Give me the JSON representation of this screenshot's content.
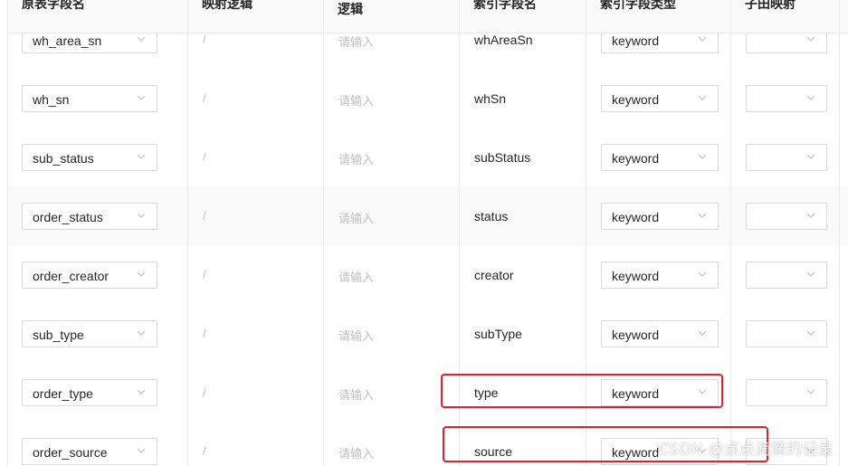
{
  "header": {
    "columns": [
      {
        "label": "原表字段名"
      },
      {
        "label": "映射逻辑"
      },
      {
        "label": "逻辑"
      },
      {
        "label": "索引字段名"
      },
      {
        "label": "索引字段类型"
      },
      {
        "label": "子田映射"
      }
    ]
  },
  "rows": [
    {
      "source": "wh_area_sn",
      "map": "/",
      "logic": "请输入",
      "field": "whAreaSn",
      "type": "keyword",
      "extra": ""
    },
    {
      "source": "wh_sn",
      "map": "/",
      "logic": "请输入",
      "field": "whSn",
      "type": "keyword",
      "extra": ""
    },
    {
      "source": "sub_status",
      "map": "/",
      "logic": "请输入",
      "field": "subStatus",
      "type": "keyword",
      "extra": ""
    },
    {
      "source": "order_status",
      "map": "/",
      "logic": "请输入",
      "field": "status",
      "type": "keyword",
      "extra": ""
    },
    {
      "source": "order_creator",
      "map": "/",
      "logic": "请输入",
      "field": "creator",
      "type": "keyword",
      "extra": ""
    },
    {
      "source": "sub_type",
      "map": "/",
      "logic": "请输入",
      "field": "subType",
      "type": "keyword",
      "extra": ""
    },
    {
      "source": "order_type",
      "map": "/",
      "logic": "请输入",
      "field": "type",
      "type": "keyword",
      "extra": ""
    },
    {
      "source": "order_source",
      "map": "/",
      "logic": "请输入",
      "field": "source",
      "type": "keyword",
      "extra": ""
    }
  ],
  "watermark": "CSDN @点点滴滴的记录",
  "colors": {
    "highlight": "#e0202c",
    "border": "#d9d9d9",
    "stripe": "#fafafa"
  }
}
